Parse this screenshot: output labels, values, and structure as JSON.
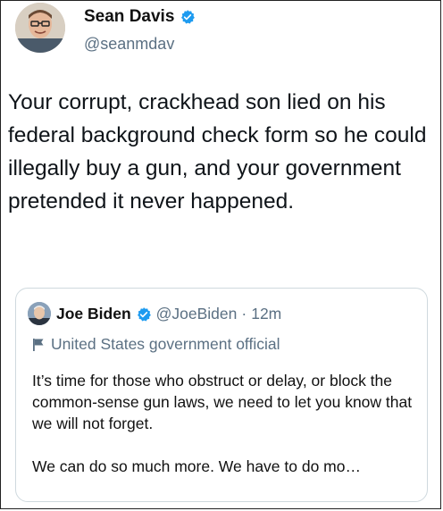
{
  "tweet": {
    "author": {
      "name": "Sean Davis",
      "handle": "@seanmdav",
      "verified": true,
      "avatar_icon": "person-avatar-icon"
    },
    "text": "Your corrupt, crackhead son lied on his federal background check form so he could illegally buy a gun, and your government pretended it never happened."
  },
  "quoted_tweet": {
    "author": {
      "name": "Joe Biden",
      "handle": "@JoeBiden",
      "separator": "·",
      "time": "12m",
      "verified": true,
      "avatar_icon": "person-avatar-icon"
    },
    "label": "United States government official",
    "label_icon": "flag-icon",
    "paragraphs": [
      "It’s time for those who obstruct or delay, or block the common-sense gun laws, we need to let you know that we will not forget.",
      "We can do so much more. We have to do mo…"
    ]
  },
  "colors": {
    "verified_blue": "#1d9bf0",
    "muted_text": "#5b7083",
    "border": "#cfd9de"
  }
}
